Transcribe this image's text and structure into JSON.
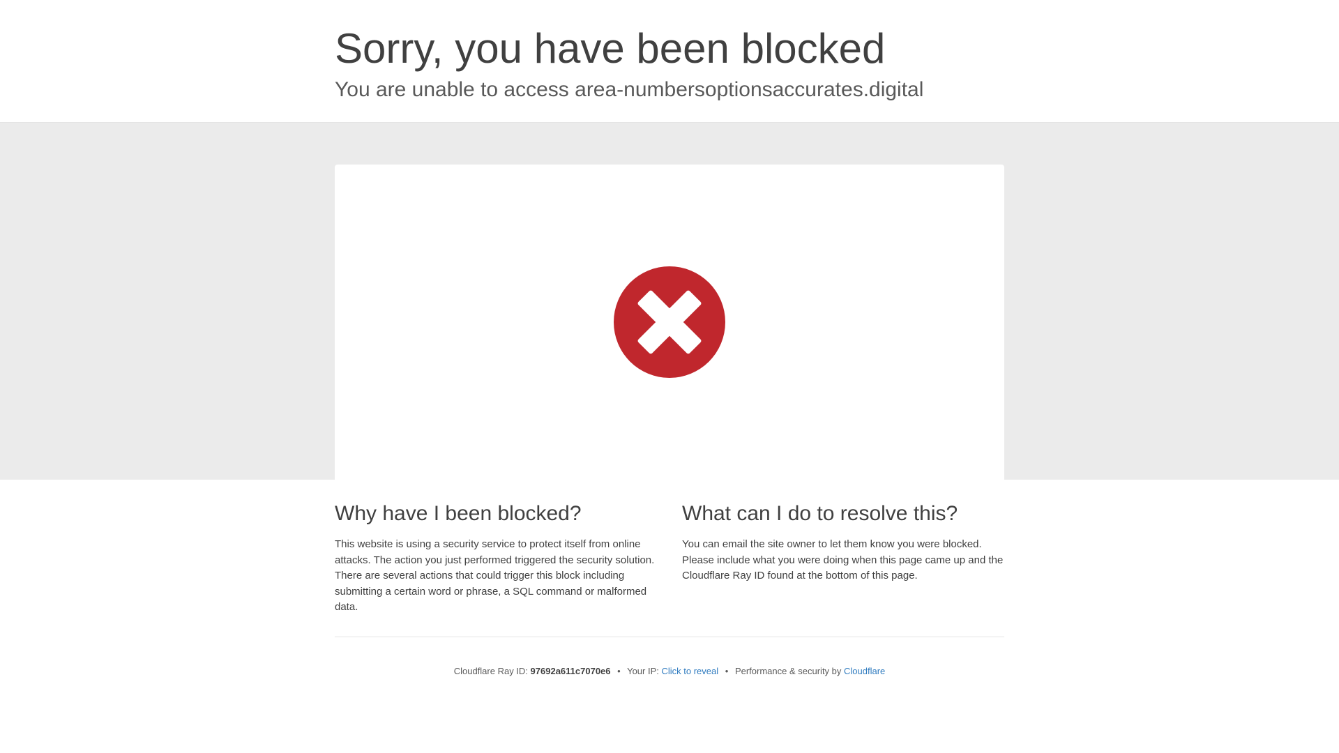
{
  "header": {
    "title": "Sorry, you have been blocked",
    "subtitle": "You are unable to access area-numbersoptionsaccurates.digital"
  },
  "icon": {
    "name": "error-x-icon",
    "color": "#c0272d"
  },
  "why": {
    "heading": "Why have I been blocked?",
    "text": "This website is using a security service to protect itself from online attacks. The action you just performed triggered the security solution. There are several actions that could trigger this block including submitting a certain word or phrase, a SQL command or malformed data."
  },
  "resolve": {
    "heading": "What can I do to resolve this?",
    "text": "You can email the site owner to let them know you were blocked. Please include what you were doing when this page came up and the Cloudflare Ray ID found at the bottom of this page."
  },
  "footer": {
    "ray_label": "Cloudflare Ray ID:",
    "ray_id": "97692a611c7070e6",
    "separator": "•",
    "ip_label": "Your IP:",
    "ip_reveal": "Click to reveal",
    "perf_label": "Performance & security by",
    "cloudflare_link": "Cloudflare"
  },
  "colors": {
    "link": "#2f7bbf",
    "band": "#ebebeb",
    "text": "#404040"
  }
}
